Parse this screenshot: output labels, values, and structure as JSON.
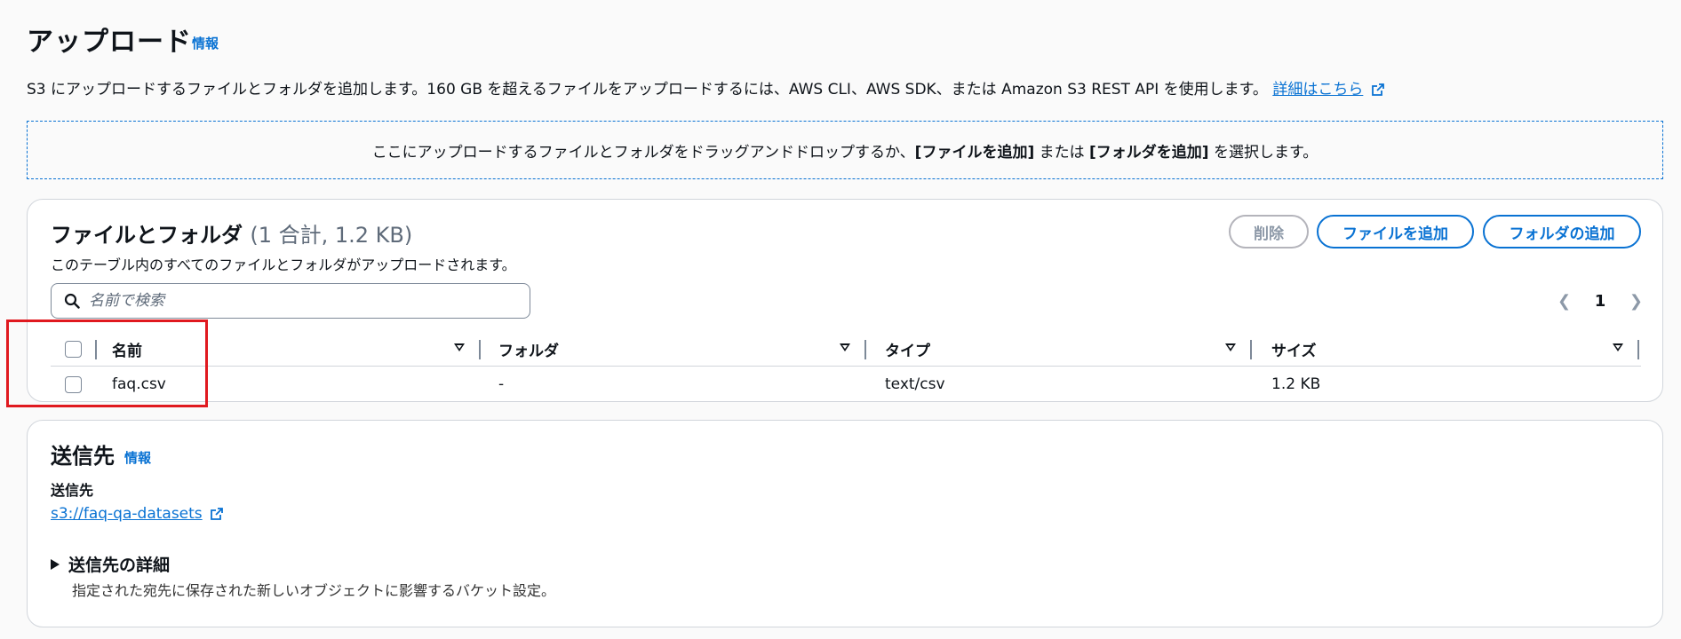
{
  "header": {
    "title": "アップロード",
    "info": "情報",
    "description": "S3 にアップロードするファイルとフォルダを追加します。160 GB を超えるファイルをアップロードするには、AWS CLI、AWS SDK、または Amazon S3 REST API を使用します。",
    "details_link": "詳細はこちら"
  },
  "dropzone": {
    "part1": "ここにアップロードするファイルとフォルダをドラッグアンドドロップするか、",
    "add_files": "[ファイルを追加]",
    "part2": " または ",
    "add_folder": "[フォルダを追加]",
    "part3": " を選択します。"
  },
  "files": {
    "title": "ファイルとフォルダ",
    "count": "(1 合計, 1.2 KB)",
    "description": "このテーブル内のすべてのファイルとフォルダがアップロードされます。",
    "delete_button": "削除",
    "add_files_button": "ファイルを追加",
    "add_folder_button": "フォルダの追加",
    "search_placeholder": "名前で検索",
    "page": "1",
    "columns": [
      "名前",
      "フォルダ",
      "タイプ",
      "サイズ"
    ],
    "rows": [
      {
        "name": "faq.csv",
        "folder": "-",
        "type": "text/csv",
        "size": "1.2 KB"
      }
    ]
  },
  "destination": {
    "title": "送信先",
    "info": "情報",
    "label": "送信先",
    "link": "s3://faq-qa-datasets",
    "details_title": "送信先の詳細",
    "details_desc": "指定された宛先に保存された新しいオブジェクトに影響するバケット設定。"
  },
  "colors": {
    "link": "#0972d3",
    "highlight": "#e0191f",
    "border": "#d1d5db"
  }
}
